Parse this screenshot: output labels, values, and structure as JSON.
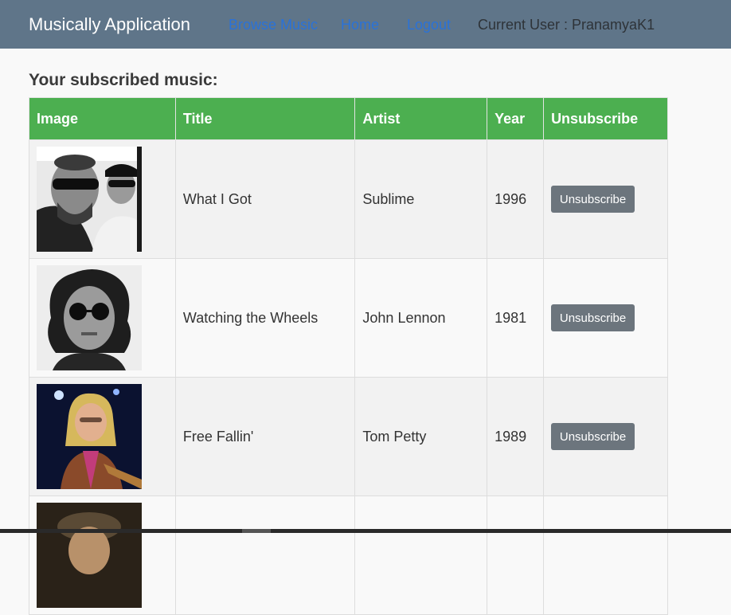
{
  "navbar": {
    "brand": "Musically Application",
    "links": [
      "Browse Music",
      "Home",
      "Logout"
    ],
    "current_user": "Current User : PranamyaK1"
  },
  "heading": "Your subscribed music:",
  "table": {
    "headers": [
      "Image",
      "Title",
      "Artist",
      "Year",
      "Unsubscribe"
    ],
    "rows": [
      {
        "title": "What I Got",
        "artist": "Sublime",
        "year": "1996",
        "button": "Unsubscribe",
        "image_icon": "band-photo-icon"
      },
      {
        "title": "Watching the Wheels",
        "artist": "John Lennon",
        "year": "1981",
        "button": "Unsubscribe",
        "image_icon": "artist-photo-icon"
      },
      {
        "title": "Free Fallin'",
        "artist": "Tom Petty",
        "year": "1989",
        "button": "Unsubscribe",
        "image_icon": "artist-photo-icon"
      },
      {
        "title": "",
        "artist": "",
        "year": "",
        "button": "",
        "image_icon": "artist-photo-icon"
      }
    ]
  },
  "colors": {
    "navbar_bg": "#5f7589",
    "header_bg": "#4caf50",
    "link": "#2a72d8",
    "button_bg": "#6c757d"
  }
}
